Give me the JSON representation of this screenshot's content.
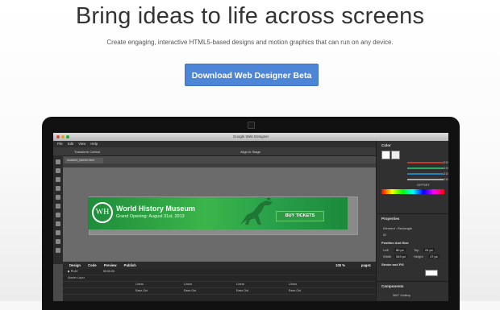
{
  "hero": {
    "title": "Bring ideas to life across screens",
    "subtitle": "Create engaging, interactive HTML5-based designs and motion graphics that can run on any device.",
    "download_label": "Download Web Designer Beta"
  },
  "app": {
    "window_title": "Google Web Designer",
    "menu": [
      "File",
      "Edit",
      "View",
      "Help"
    ],
    "toolbar": {
      "left_label": "Transform Control",
      "center_label": "Align to Stage"
    },
    "doc_tab": "museum_banner.html",
    "banner": {
      "logo_text": "WH",
      "museum_title": "World History Museum",
      "opening_text": "Grand Opening: August 31st, 2013",
      "cta_label": "BUY TICKETS"
    },
    "bottom_tabs": {
      "design": "Design",
      "code": "Code",
      "preview": "Preview",
      "publish": "Publish"
    },
    "zoom": "100 %",
    "page": "page1",
    "timeline": {
      "play": "▶ PLAY",
      "time": "00:00.00",
      "master_layer": "Master Layer",
      "rows": [
        "Linear",
        "Ease-Out"
      ]
    },
    "panel": {
      "color_title": "Color",
      "offset_label": "OFFSET",
      "color_values": [
        "215",
        "215",
        "215",
        "215"
      ],
      "properties_title": "Properties",
      "element_label": "Element : Rectangle",
      "id_label": "ID",
      "position_title": "Position And Size",
      "left_label": "Left",
      "left_value": "80 px",
      "top_label": "Top",
      "top_value": "24 px",
      "width_label": "Width",
      "width_value": "349 px",
      "height_label": "Height",
      "height_value": "17 px",
      "stroke_title": "Stroke and Fill",
      "components_title": "Components",
      "component_item": "360° Gallery"
    }
  }
}
